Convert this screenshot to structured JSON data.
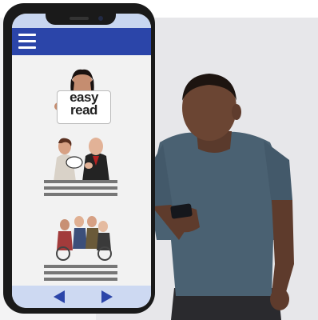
{
  "phone": {
    "menu_icon": "hamburger-menu-icon",
    "easy_read_sign": {
      "line1": "easy",
      "line2": "read"
    },
    "nav": {
      "prev_icon": "arrow-left-icon",
      "next_icon": "arrow-right-icon"
    }
  },
  "colors": {
    "header_blue": "#2b45a9",
    "footer_blue": "#cdd9f2",
    "shirt": "#4a6172",
    "background_panel": "#e7e7ea"
  }
}
